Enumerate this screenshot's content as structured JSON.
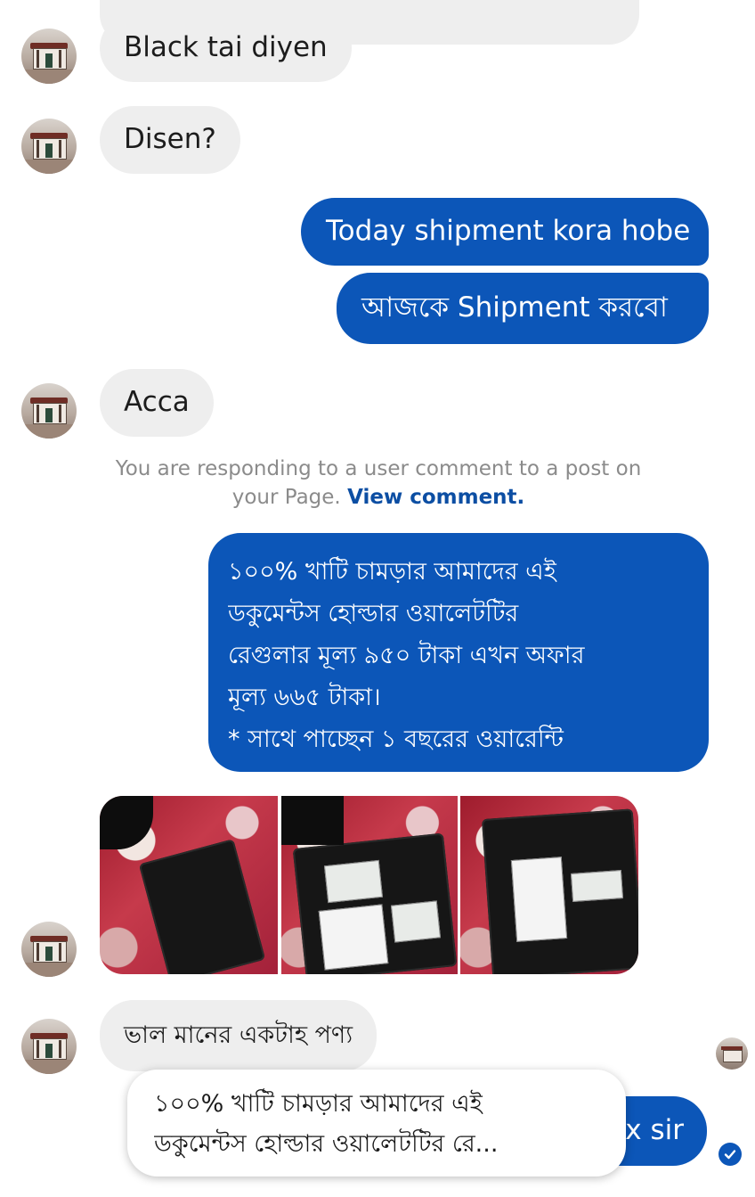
{
  "messages": {
    "m1": "Black tai diyen",
    "m2": "Disen?",
    "m3": "Today shipment kora hobe",
    "m4": "আজকে Shipment করবো",
    "m5": "Acca",
    "notice_text": "You are responding to a user comment to a post on your Page.",
    "notice_link": "View comment.",
    "offer_lines": [
      "১০০% খাটি চামড়ার আমাদের এই",
      "ডকুমেন্টস হোল্ডার ওয়ালেটটির",
      "রেগুলার মূল্য ৯৫০ টাকা এখন অফার",
      "মূল্য ৬৬৫ টাকা।",
      "* সাথে পাচ্ছেন ১ বছরের ওয়ারেন্টি"
    ],
    "m6": "ভাল মানের একটাহ পণ্য",
    "m7_partial": "x sir"
  },
  "reply_preview": {
    "line1": "১০০% খাটি চামড়ার আমাদের এই",
    "line2": "ডকুমেন্টস হোল্ডার ওয়ালেটটির রে..."
  },
  "colors": {
    "outgoing": "#0c56b8",
    "incoming": "#eeeeee",
    "link": "#0c4ea3"
  },
  "icons": {
    "seen": "check-icon"
  }
}
